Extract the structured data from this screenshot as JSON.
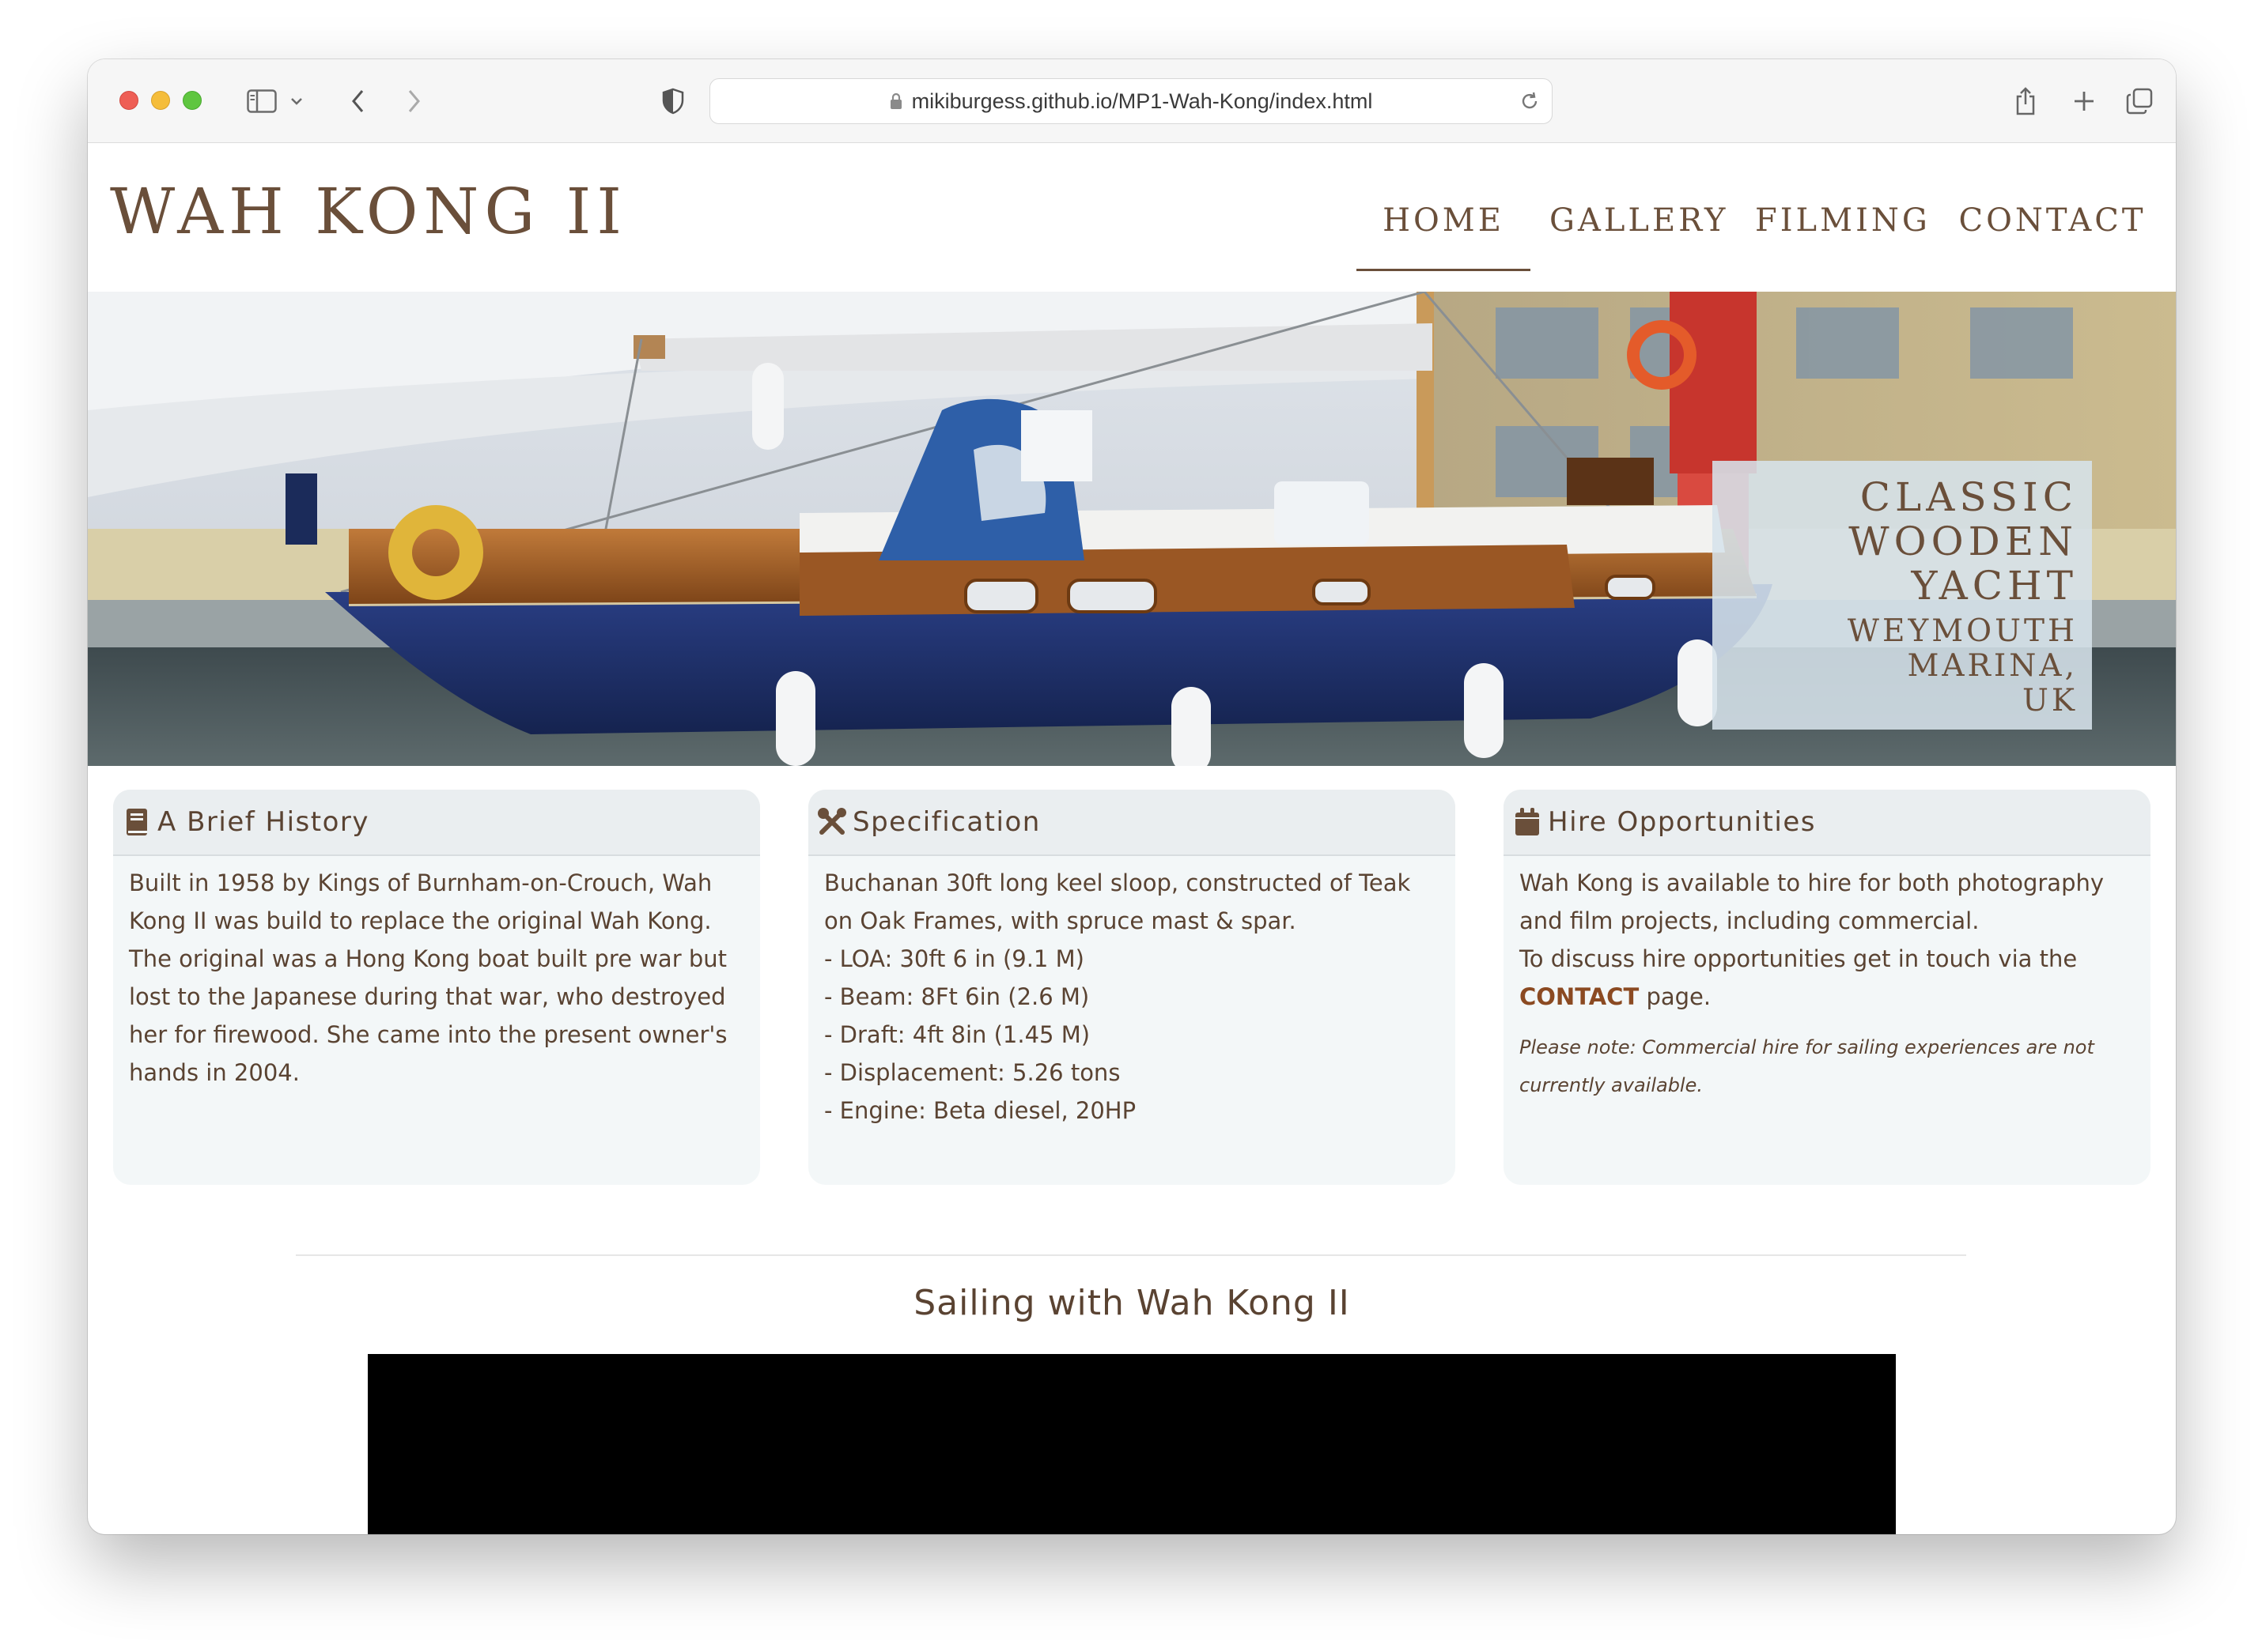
{
  "browser": {
    "url": "mikiburgess.github.io/MP1-Wah-Kong/index.html"
  },
  "site": {
    "brand": "WAH KONG II",
    "nav": {
      "home": "HOME",
      "gallery": "GALLERY",
      "filming": "FILMING",
      "contact": "CONTACT",
      "active": "HOME"
    },
    "hero": {
      "title_lines": [
        "CLASSIC",
        "WOODEN",
        "YACHT"
      ],
      "subtitle_lines": [
        "WEYMOUTH MARINA,",
        "UK"
      ]
    },
    "cards": [
      {
        "title": "A Brief History",
        "icon": "book-icon",
        "lines": [
          "Built in 1958 by Kings of Burnham-on-Crouch, Wah",
          "Kong II was build to replace the original Wah Kong.",
          "The original was a Hong Kong boat built pre war but",
          "lost to the Japanese during that war, who destroyed",
          "her for firewood. She came into the present owner's",
          "hands in 2004."
        ]
      },
      {
        "title": "Specification",
        "icon": "tools-icon",
        "lines": [
          "Buchanan 30ft long keel sloop, constructed of Teak",
          "on Oak Frames, with spruce mast & spar.",
          "- LOA: 30ft 6 in (9.1 M)",
          "- Beam: 8Ft 6in (2.6 M)",
          "- Draft: 4ft 8in (1.45 M)",
          "- Displacement: 5.26 tons",
          "- Engine: Beta diesel, 20HP"
        ]
      },
      {
        "title": "Hire Opportunities",
        "icon": "calendar-icon",
        "lines": [
          "Wah Kong is available to hire for both photography",
          "and film projects, including commercial.",
          "To discuss hire opportunities get in touch via the"
        ],
        "link_text": "CONTACT",
        "after_link": " page.",
        "note_lines": [
          "Please note: Commercial hire for sailing experiences are not",
          "currently available."
        ]
      }
    ],
    "video_section": {
      "title": "Sailing with Wah Kong II"
    }
  },
  "colors": {
    "brand_brown": "#6a4f3a",
    "link_brown": "#8b4a22",
    "card_bg": "#f3f7f8",
    "hull_blue": "#1d2f6b"
  }
}
